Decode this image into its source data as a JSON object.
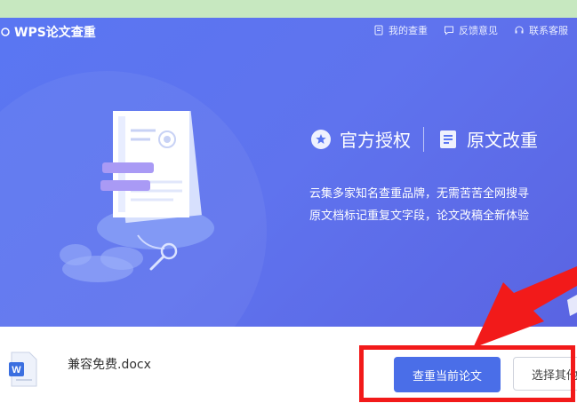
{
  "app": {
    "brand": "WPS论文查重"
  },
  "topnav": [
    {
      "label": "我的查重",
      "icon": "document-icon"
    },
    {
      "label": "反馈意见",
      "icon": "message-icon"
    },
    {
      "label": "联系客服",
      "icon": "headset-icon"
    }
  ],
  "features": [
    {
      "label": "官方授权",
      "icon": "badge-star-icon"
    },
    {
      "label": "原文改重",
      "icon": "edit-document-icon"
    }
  ],
  "description": {
    "line1": "云集多家知名查重品牌，无需苦苦全网搜寻",
    "line2": "原文档标记重复文字段，论文改稿全新体验"
  },
  "file": {
    "name": "兼容免费.docx",
    "icon": "word-doc-icon"
  },
  "buttons": {
    "primary": "查重当前论文",
    "secondary": "选择其他"
  },
  "colors": {
    "hero": "#5a76f2",
    "primary_button": "#4a6ee8",
    "annotation": "#f21a1a"
  }
}
